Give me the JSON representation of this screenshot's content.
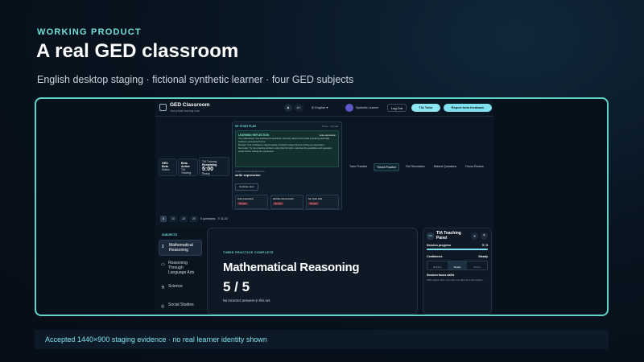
{
  "hero": {
    "eyebrow": "WORKING PRODUCT",
    "title": "A real GED classroom",
    "subtitle": "English desktop staging · fictional synthetic learner · four GED subjects"
  },
  "app": {
    "title": "GED Classroom",
    "tagline": "Your private learning room",
    "header": {
      "font_small": "A",
      "font_large": "A+",
      "language": "English",
      "learner": "Synthetic Learner",
      "logout": "Log Out",
      "tia_tutor": "TIA Tutor",
      "feedback": "Report beta feedback"
    },
    "stats": [
      {
        "label": "GED Beta",
        "sub": "Status"
      },
      {
        "label": "Beta Active",
        "sub": "TIA Tutoring"
      },
      {
        "label": "TIA Tutoring",
        "sub": "Remaining",
        "value": "5:00",
        "note": "Ready"
      }
    ],
    "study_plan": {
      "eyebrow": "MY STUDY PLAN",
      "right": "5 due · 15 total",
      "reflection_title": "LEARNING REFLECTION",
      "reflection_tag": "write expression",
      "reflection_text": "You understood: You answered 6 questions correctly without hints while practicing decimals, fractions, and percent error.",
      "review_text": "Review: Your confidence stayed steady. A helpful review focus is writing an expression.",
      "next_text": "Next step: Try one practice problem using this first trick: underline the quantities and operation words before writing the expression.",
      "recommended_label": "Today's recommended focus",
      "focus": "write expression",
      "continue": "Continue plan",
      "cards": [
        {
          "title": "write expression",
          "tag": "Review"
        },
        {
          "title": "add like denominator",
          "tag": "Review"
        },
        {
          "title": "bar chart total",
          "tag": "Review"
        }
      ]
    },
    "tabs": [
      "Tutor Practice",
      "Timed Practice",
      "Full Simulation",
      "Missed Questions",
      "Focus Review"
    ],
    "active_tab": "Timed Practice",
    "counts": [
      "5",
      "10",
      "15",
      "20"
    ],
    "active_count": "5",
    "count_summary": "5 questions",
    "timer": "⏱ 11:22"
  },
  "subjects": {
    "heading": "SUBJECTS",
    "items": [
      {
        "label": "Mathematical Reasoning",
        "icon": "Σ"
      },
      {
        "label": "Reasoning Through Language Arts",
        "icon": "▭"
      },
      {
        "label": "Science",
        "icon": "⚗"
      },
      {
        "label": "Social Studies",
        "icon": "◎"
      }
    ],
    "active": "Mathematical Reasoning"
  },
  "result": {
    "eyebrow": "TIMED PRACTICE COMPLETE",
    "title": "Mathematical Reasoning",
    "score": "5 / 5",
    "note": "No incorrect answers in this set."
  },
  "tia_panel": {
    "badge": "TIA",
    "title": "TIA Teaching Panel",
    "progress_label": "Session progress",
    "progress_value": "5 / 5",
    "progress_fraction": 1.0,
    "confidence_label": "Confidence",
    "confidence_value": "Steady",
    "confidence_options": [
      "Building",
      "Steady",
      "Strong"
    ],
    "confidence_active": "Steady",
    "focus_label": "Session focus skills",
    "focus_text": "Skills appear after more than one attempt in this session."
  },
  "caption": "Accepted 1440×900 staging evidence · no real learner identity shown",
  "colors": {
    "accent": "#6ee0d6",
    "button": "#7fe1ef",
    "background": "#081420"
  }
}
